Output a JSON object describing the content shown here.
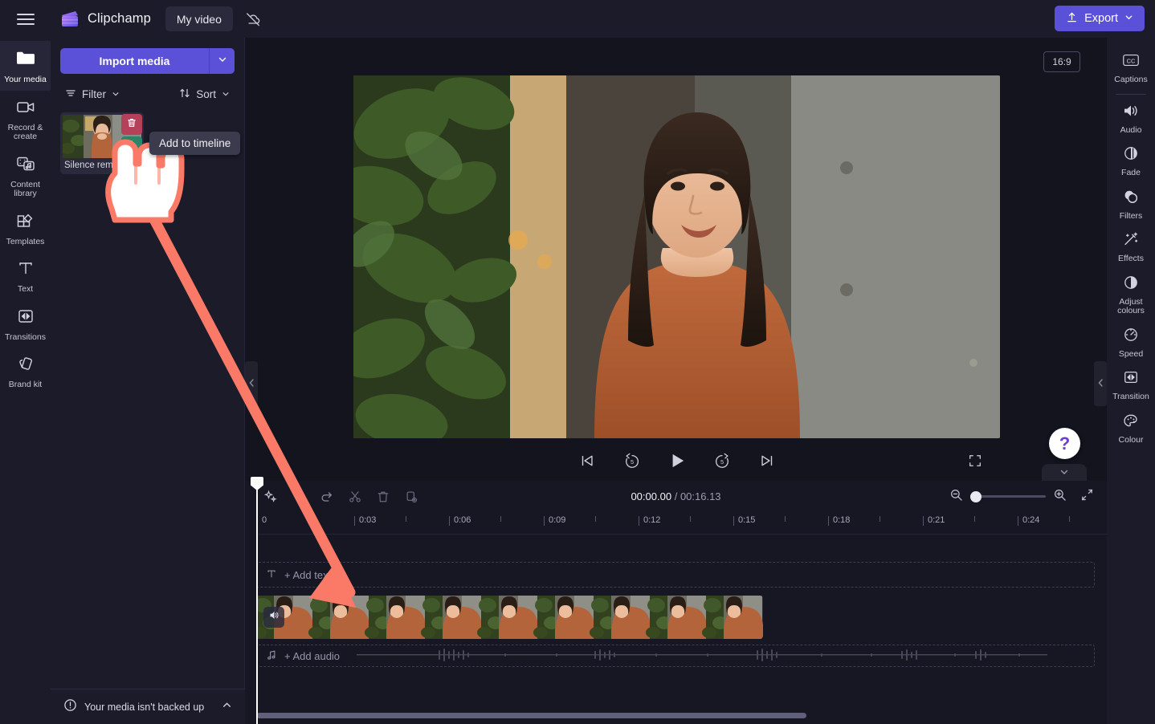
{
  "app": {
    "brand": "Clipchamp",
    "project_name": "My video",
    "menu_icon": "hamburger-icon",
    "cloud_off_icon": "cloud-offline-icon",
    "export_label": "Export",
    "export_icon": "upload-icon",
    "accent": "#5b51d8",
    "background": "#14141f",
    "panel_bg": "#1b1b29"
  },
  "left_rail": {
    "items": [
      {
        "label": "Your media",
        "icon": "folder-icon",
        "active": true
      },
      {
        "label": "Record & create",
        "icon": "video-camera-icon",
        "active": false
      },
      {
        "label": "Content library",
        "icon": "content-library-icon",
        "active": false
      },
      {
        "label": "Templates",
        "icon": "templates-icon",
        "active": false
      },
      {
        "label": "Text",
        "icon": "text-icon",
        "active": false
      },
      {
        "label": "Transitions",
        "icon": "transitions-icon",
        "active": false
      },
      {
        "label": "Brand kit",
        "icon": "brand-kit-icon",
        "active": false
      }
    ]
  },
  "media_panel": {
    "import_label": "Import media",
    "import_caret_icon": "chevron-down-icon",
    "filter_label": "Filter",
    "filter_icon": "filter-icon",
    "sort_label": "Sort",
    "sort_icon": "sort-arrows-icon",
    "items": [
      {
        "name": "Silence remov...",
        "delete_icon": "trash-icon",
        "add_icon": "plus-icon"
      }
    ],
    "backup_notice": "Your media isn't backed up",
    "backup_icon": "alert-circle-icon",
    "backup_chevron": "chevron-up-icon"
  },
  "tooltip": {
    "text": "Add to timeline"
  },
  "preview": {
    "aspect_ratio": "16:9",
    "collapse_left_icon": "chevron-left-icon",
    "collapse_right_icon": "chevron-left-icon",
    "help_icon": "question-mark-icon",
    "controls": [
      {
        "name": "skip-to-start",
        "icon": "skip-back-icon"
      },
      {
        "name": "rewind-5",
        "icon": "rewind-5-icon"
      },
      {
        "name": "play",
        "icon": "play-icon"
      },
      {
        "name": "forward-5",
        "icon": "forward-5-icon"
      },
      {
        "name": "skip-to-end",
        "icon": "skip-forward-icon"
      }
    ],
    "fullscreen_icon": "fullscreen-icon"
  },
  "right_rail": {
    "items": [
      {
        "label": "Captions",
        "icon": "closed-captions-icon",
        "separator_after": true
      },
      {
        "label": "Audio",
        "icon": "speaker-icon",
        "separator_after": false
      },
      {
        "label": "Fade",
        "icon": "fade-icon",
        "separator_after": false
      },
      {
        "label": "Filters",
        "icon": "filters-icon",
        "separator_after": false
      },
      {
        "label": "Effects",
        "icon": "magic-wand-icon",
        "separator_after": false
      },
      {
        "label": "Adjust colours",
        "icon": "contrast-icon",
        "separator_after": false
      },
      {
        "label": "Speed",
        "icon": "speedometer-icon",
        "separator_after": false
      },
      {
        "label": "Transition",
        "icon": "transitions-icon",
        "separator_after": false
      },
      {
        "label": "Colour",
        "icon": "palette-icon",
        "separator_after": false
      }
    ]
  },
  "timeline": {
    "tools": [
      {
        "name": "auto-compose",
        "icon": "sparkle-icon",
        "disabled": false
      },
      {
        "name": "undo",
        "icon": "undo-icon",
        "disabled": true
      },
      {
        "name": "redo",
        "icon": "redo-icon",
        "disabled": true
      },
      {
        "name": "split",
        "icon": "scissors-icon",
        "disabled": true
      },
      {
        "name": "delete",
        "icon": "trash-icon",
        "disabled": true
      },
      {
        "name": "duplicate",
        "icon": "duplicate-icon",
        "disabled": true
      }
    ],
    "current_time": "00:00.00",
    "total_time": "00:16.13",
    "time_separator": "/",
    "zoom_out_icon": "zoom-out-icon",
    "zoom_in_icon": "zoom-in-icon",
    "fit_icon": "fit-to-screen-icon",
    "zoom_value": 0,
    "ruler_labels": [
      "0",
      "0:03",
      "0:06",
      "0:09",
      "0:12",
      "0:15",
      "0:18",
      "0:21",
      "0:24"
    ],
    "text_track": {
      "label": "+ Add text",
      "icon": "text-icon"
    },
    "audio_track": {
      "label": "+ Add audio",
      "icon": "music-note-icon"
    },
    "video_clip": {
      "mute_icon": "speaker-icon",
      "frames": 9
    }
  }
}
